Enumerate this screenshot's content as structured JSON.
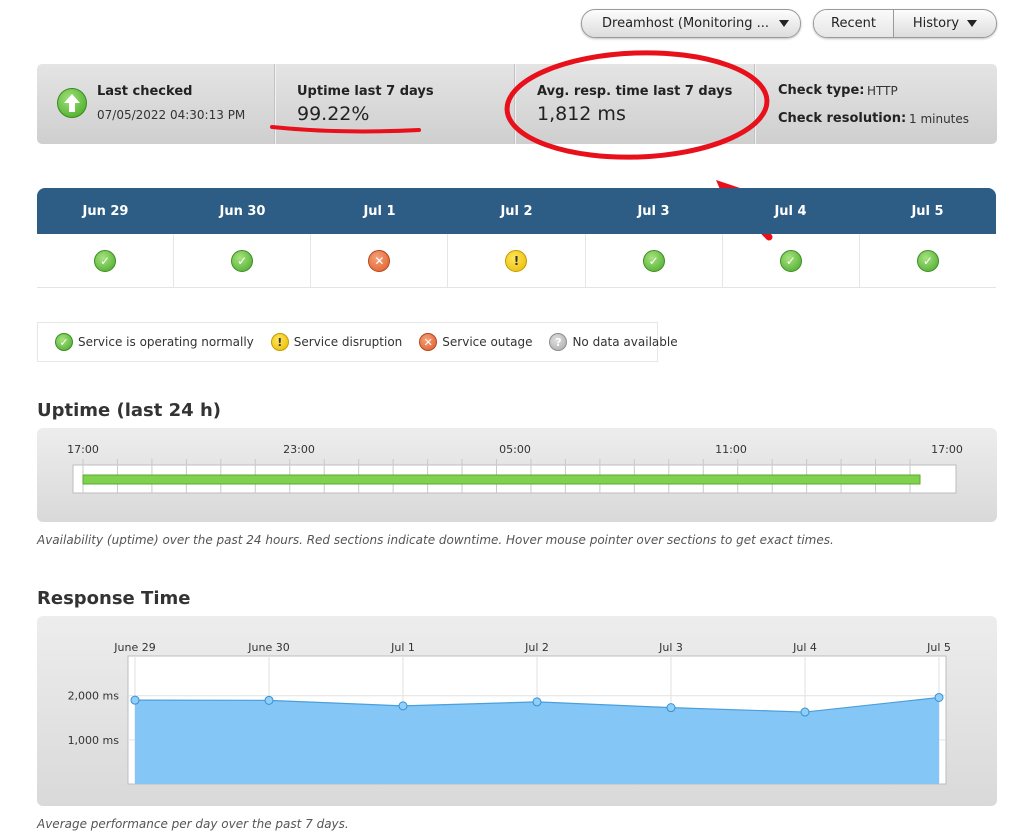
{
  "header": {
    "monitor_select": "Dreamhost (Monitoring ...",
    "recent_label": "Recent",
    "history_label": "History"
  },
  "stats": {
    "last_checked_label": "Last checked",
    "last_checked_value": "07/05/2022 04:30:13 PM",
    "uptime_label": "Uptime last 7 days",
    "uptime_value": "99.22%",
    "resp_label": "Avg. resp. time last 7 days",
    "resp_value": "1,812 ms",
    "check_type_label": "Check type:",
    "check_type_value": "HTTP",
    "check_res_label": "Check resolution:",
    "check_res_value": "1 minutes"
  },
  "calendar": {
    "days": [
      {
        "label": "Jun 29",
        "status": "ok"
      },
      {
        "label": "Jun 30",
        "status": "ok"
      },
      {
        "label": "Jul 1",
        "status": "outage"
      },
      {
        "label": "Jul 2",
        "status": "disruption"
      },
      {
        "label": "Jul 3",
        "status": "ok"
      },
      {
        "label": "Jul 4",
        "status": "ok"
      },
      {
        "label": "Jul 5",
        "status": "ok"
      }
    ]
  },
  "legend": {
    "normal": "Service is operating normally",
    "disruption": "Service disruption",
    "outage": "Service outage",
    "no_data": "No data available"
  },
  "uptime24": {
    "title": "Uptime (last 24 h)",
    "ticks": [
      "17:00",
      "23:00",
      "05:00",
      "11:00",
      "17:00"
    ],
    "availability_fraction": 1.0,
    "caption": "Availability (uptime) over the past 24 hours. Red sections indicate downtime. Hover mouse pointer over sections to get exact times."
  },
  "response": {
    "title": "Response Time",
    "caption": "Average performance per day over the past 7 days."
  },
  "colors": {
    "header_blue": "#2d5d85",
    "uptime_green": "#7fd14e",
    "area_fill": "#7dc4f5",
    "annotation_red": "#e8101a"
  },
  "chart_data": {
    "type": "area",
    "categories": [
      "June 29",
      "June 30",
      "Jul 1",
      "Jul 2",
      "Jul 3",
      "Jul 4",
      "Jul 5"
    ],
    "series": [
      {
        "values": [
          1900,
          1895,
          1770,
          1860,
          1730,
          1630,
          1960
        ]
      }
    ],
    "yticks": [
      "2,000 ms",
      "1,000 ms"
    ],
    "ytick_values": [
      2000,
      1000
    ],
    "ylim": [
      0,
      2900
    ],
    "grid": true
  }
}
